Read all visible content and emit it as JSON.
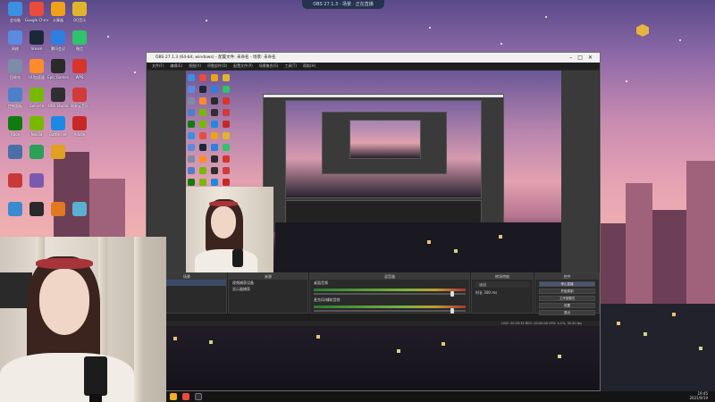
{
  "top_pill": {
    "text": "OBS 27.1.3 · 场景 · 正在直播"
  },
  "desktop": {
    "icons": [
      {
        "label": "此电脑",
        "color": "#3d8fe0"
      },
      {
        "label": "Google Chrome",
        "color": "#e94b3c"
      },
      {
        "label": "计算器",
        "color": "#f0a11a"
      },
      {
        "label": "QQ音乐",
        "color": "#e0b52d"
      },
      {
        "label": "网络",
        "color": "#5a8be0"
      },
      {
        "label": "Steam",
        "color": "#1b2838"
      },
      {
        "label": "腾讯会议",
        "color": "#2d7fe0"
      },
      {
        "label": "微信",
        "color": "#2fc36b"
      },
      {
        "label": "回收站",
        "color": "#7d8ca8"
      },
      {
        "label": "UU加速器",
        "color": "#ff8c2b"
      },
      {
        "label": "Epic Games",
        "color": "#2a2a2a"
      },
      {
        "label": "WPS",
        "color": "#d9342b"
      },
      {
        "label": "控制面板",
        "color": "#4c80c8"
      },
      {
        "label": "GeForce",
        "color": "#76b900"
      },
      {
        "label": "OBS Studio",
        "color": "#302e31"
      },
      {
        "label": "网易云音乐",
        "color": "#d23b3b"
      },
      {
        "label": "Xbox",
        "color": "#107c10"
      },
      {
        "label": "Nvidia",
        "color": "#76b900"
      },
      {
        "label": "Battle.net",
        "color": "#1e88e5"
      },
      {
        "label": "Adobe",
        "color": "#c62828"
      }
    ]
  },
  "obs": {
    "title": "OBS 27.1.3 (64-bit, windows) - 配置文件: 未命名 - 场景: 未命名",
    "menu": [
      "文件(F)",
      "编辑(E)",
      "视图(V)",
      "停靠部件(D)",
      "配置文件(P)",
      "场景集合(S)",
      "工具(T)",
      "帮助(H)"
    ],
    "docks": {
      "scenes": {
        "title": "场景",
        "items": [
          "场景"
        ]
      },
      "sources": {
        "title": "来源",
        "items": [
          "视频捕获设备",
          "显示器捕获"
        ]
      },
      "mixer": {
        "title": "混音器",
        "channels": [
          {
            "name": "桌面音频",
            "level": "0.0 dB"
          },
          {
            "name": "麦克风/辅助音频",
            "level": "0.0 dB"
          }
        ]
      },
      "transitions": {
        "title": "转场特效",
        "type": "淡出",
        "duration_label": "时长",
        "duration": "300 ms"
      },
      "controls": {
        "title": "控件",
        "buttons": [
          "停止直播",
          "开始录制",
          "工作室模式",
          "设置",
          "退出"
        ]
      }
    },
    "status": "LIVE: 00:29:32   REC: 00:00:00   CPU: 4.1%, 30.00 fps"
  },
  "taskbar": {
    "time": "19:45",
    "date": "2021/9/19"
  }
}
